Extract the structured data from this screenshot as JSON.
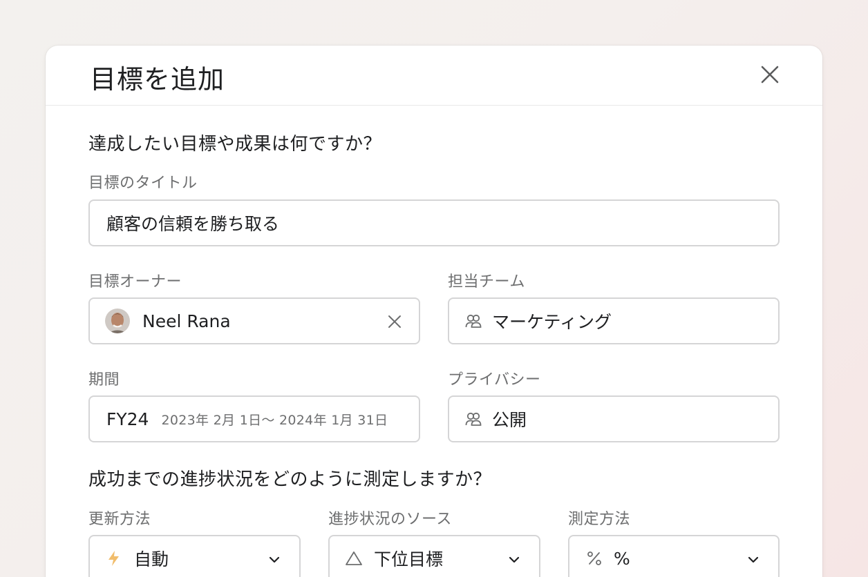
{
  "dialog": {
    "title": "目標を追加"
  },
  "section_goal": {
    "question": "達成したい目標や成果は何ですか？",
    "title_label": "目標のタイトル",
    "title_value": "顧客の信頼を勝ち取る",
    "owner_label": "目標オーナー",
    "owner_value": "Neel Rana",
    "team_label": "担当チーム",
    "team_value": "マーケティング",
    "period_label": "期間",
    "period_value": "FY24",
    "period_range": "2023年 2月 1日～ 2024年 1月 31日",
    "privacy_label": "プライバシー",
    "privacy_value": "公開"
  },
  "section_progress": {
    "question": "成功までの進捗状況をどのように測定しますか？",
    "update_label": "更新方法",
    "update_value": "自動",
    "source_label": "進捗状況のソース",
    "source_value": "下位目標",
    "measure_label": "測定方法",
    "measure_value": "%"
  },
  "icons": {
    "close": "close-icon",
    "clear": "clear-icon",
    "team": "team-icon",
    "bolt": "lightning-icon",
    "triangle": "triangle-icon",
    "percent": "percent-icon",
    "chevron": "chevron-down-icon"
  },
  "colors": {
    "bolt": "#f1bd6c",
    "border": "#d5d5d6",
    "label": "#6d6e6f",
    "text": "#1e1f21"
  }
}
